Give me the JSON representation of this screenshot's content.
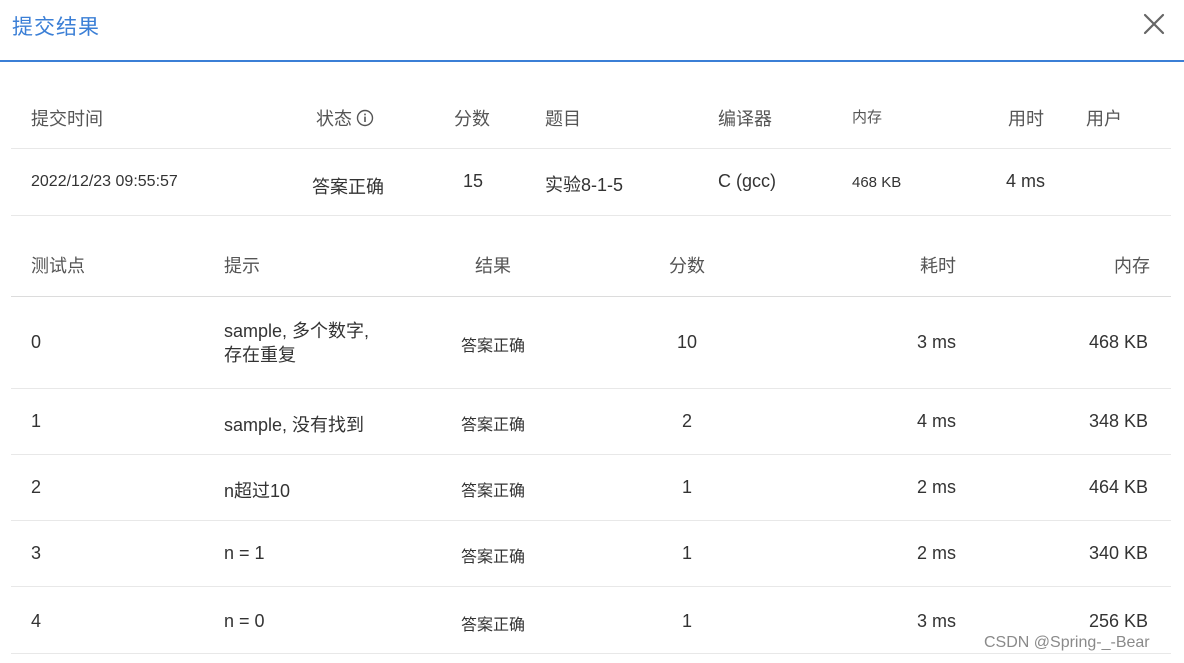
{
  "dialog": {
    "title": "提交结果"
  },
  "summary": {
    "headers": {
      "time": "提交时间",
      "status": "状态",
      "score": "分数",
      "problem": "题目",
      "compiler": "编译器",
      "memory": "内存",
      "time_used": "用时",
      "user": "用户"
    },
    "row": {
      "time": "2022/12/23 09:55:57",
      "status": "答案正确",
      "score": "15",
      "problem": "实验8-1-5",
      "compiler": "C (gcc)",
      "memory": "468 KB",
      "time_used": "4 ms",
      "user": ""
    }
  },
  "tests": {
    "headers": {
      "case": "测试点",
      "hint": "提示",
      "result": "结果",
      "score": "分数",
      "time": "耗时",
      "memory": "内存"
    },
    "rows": [
      {
        "case": "0",
        "hint_line1": "sample, 多个数字,",
        "hint_line2": "存在重复",
        "result": "答案正确",
        "score": "10",
        "time": "3 ms",
        "memory": "468 KB"
      },
      {
        "case": "1",
        "hint_line1": "sample, 没有找到",
        "hint_line2": "",
        "result": "答案正确",
        "score": "2",
        "time": "4 ms",
        "memory": "348 KB"
      },
      {
        "case": "2",
        "hint_line1": "n超过10",
        "hint_line2": "",
        "result": "答案正确",
        "score": "1",
        "time": "2 ms",
        "memory": "464 KB"
      },
      {
        "case": "3",
        "hint_line1": "n = 1",
        "hint_line2": "",
        "result": "答案正确",
        "score": "1",
        "time": "2 ms",
        "memory": "340 KB"
      },
      {
        "case": "4",
        "hint_line1": "n = 0",
        "hint_line2": "",
        "result": "答案正确",
        "score": "1",
        "time": "3 ms",
        "memory": "256 KB"
      }
    ]
  },
  "watermark": "CSDN @Spring-_-Bear",
  "icons": {
    "close": "close-icon",
    "info": "info-icon"
  },
  "colors": {
    "accent": "#3b7fd6",
    "accepted": "#e0332f"
  }
}
